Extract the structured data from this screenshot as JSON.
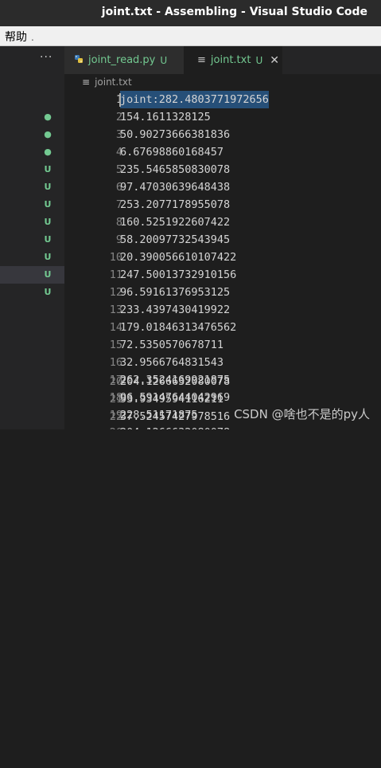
{
  "window": {
    "title": "joint.txt - Assembling - Visual Studio Code"
  },
  "menubar": {
    "items": [
      "帮助"
    ]
  },
  "sidebar": {
    "more": "···",
    "badges": [
      "●",
      "●",
      "●",
      "U",
      "U",
      "U",
      "U",
      "U",
      "U",
      "U",
      "U"
    ]
  },
  "tabs": [
    {
      "label": "joint_read.py",
      "status": "U",
      "icon": "python-icon"
    },
    {
      "label": "joint.txt",
      "status": "U",
      "icon": "text-file-icon"
    }
  ],
  "breadcrumb": {
    "file": "joint.txt"
  },
  "editor": {
    "lines": [
      {
        "n": "1",
        "text": "joint:282.4803771972656"
      },
      {
        "n": "2",
        "text": "154.1611328125"
      },
      {
        "n": "3",
        "text": "50.90273666381836"
      },
      {
        "n": "4",
        "text": "6.67698860168457"
      },
      {
        "n": "5",
        "text": "235.5465850830078"
      },
      {
        "n": "6",
        "text": "97.47030639648438"
      },
      {
        "n": "7",
        "text": "253.2077178955078"
      },
      {
        "n": "8",
        "text": "160.5251922607422"
      },
      {
        "n": "9",
        "text": "58.20097732543945"
      },
      {
        "n": "10",
        "text": "20.390056610107422"
      },
      {
        "n": "11",
        "text": "247.50013732910156"
      },
      {
        "n": "12",
        "text": "96.59161376953125"
      },
      {
        "n": "13",
        "text": "233.4397430419922"
      },
      {
        "n": "14",
        "text": "179.01846313476562"
      },
      {
        "n": "15",
        "text": "72.5350570678711"
      },
      {
        "n": "16",
        "text": "32.9566764831543"
      },
      {
        "n": "17",
        "text": "262.3524169921875"
      },
      {
        "n": "18",
        "text": "96.59147644042969"
      },
      {
        "n": "19",
        "text": "228.51171875"
      },
      {
        "n": "20",
        "text": "204.1266632080078"
      },
      {
        "n": "21",
        "text": "93.9349594116211"
      },
      {
        "n": "22",
        "text": "37.52457427978516"
      }
    ]
  },
  "watermark": "CSDN @啥也不是的py人",
  "colors": {
    "accent_untracked": "#73c991",
    "selection": "#264f78"
  }
}
